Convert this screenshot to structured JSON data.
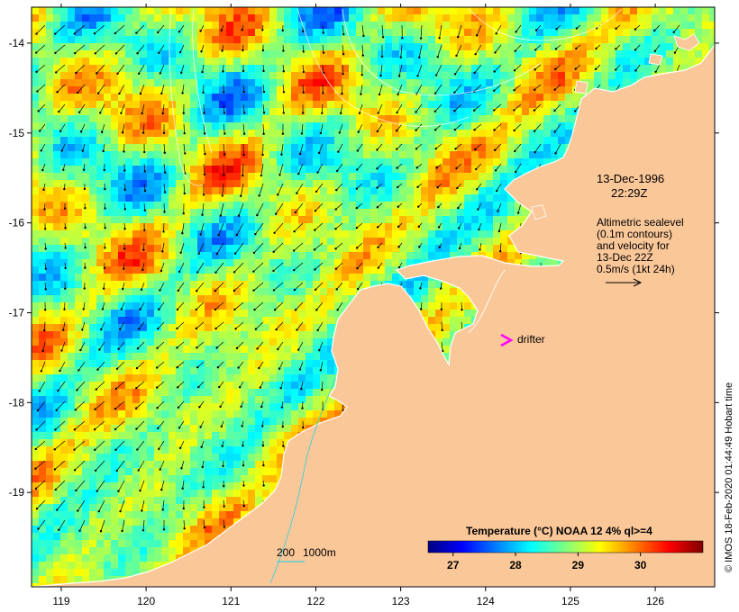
{
  "map": {
    "lon_ticks": [
      119,
      120,
      121,
      122,
      123,
      124,
      125,
      126
    ],
    "lat_ticks": [
      -14,
      -15,
      -16,
      -17,
      -18,
      -19
    ],
    "lon_range": [
      118.65,
      126.7
    ],
    "lat_range": [
      -13.6,
      -20.05
    ]
  },
  "annotation": {
    "date": "13-Dec-1996",
    "time": "22:29Z",
    "sealevel_lines": [
      "Altimetric sealevel",
      "(0.1m contours)",
      "and velocity for",
      "13-Dec 22Z",
      "0.5m/s (1kt 24h)"
    ]
  },
  "drifter": {
    "symbol": ">",
    "label": "drifter",
    "color": "#ff00ff"
  },
  "depth_legend": {
    "shallow": "200",
    "deep": "1000m"
  },
  "colorbar": {
    "title": "Temperature (°C) NOAA 12 4% ql>=4",
    "ticks": [
      "27",
      "28",
      "29",
      "30"
    ],
    "tick_values": [
      27,
      28,
      29,
      30
    ],
    "range": [
      26.6,
      31.0
    ],
    "colors": [
      "#00007f",
      "#0000ff",
      "#007fff",
      "#00ffff",
      "#7fff7f",
      "#ffff00",
      "#ff7f00",
      "#ff0000",
      "#7f0000"
    ]
  },
  "credit": "© IMOS 18-Feb-2020 01:44:49 Hobart time",
  "colors": {
    "land": "#fac798",
    "coast": "#ffffff",
    "arrows": "#000000"
  }
}
